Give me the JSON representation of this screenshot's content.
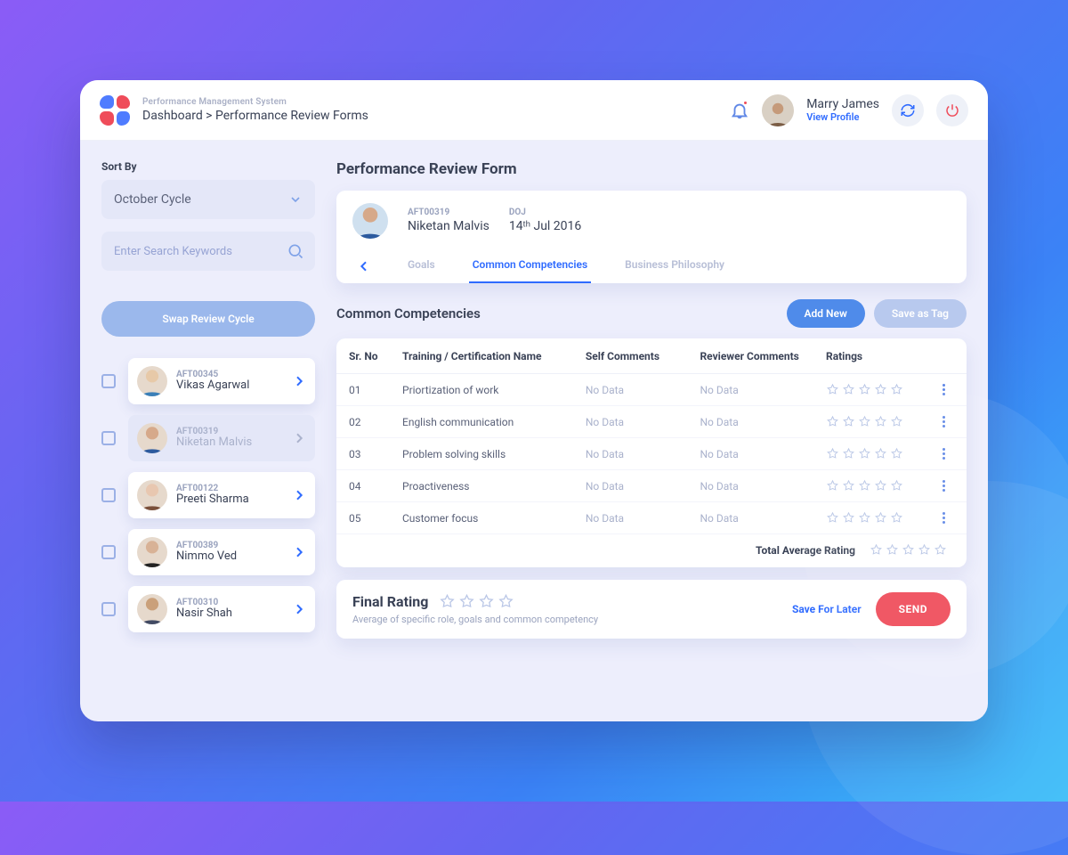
{
  "header": {
    "app_name": "Performance Management System",
    "breadcrumb": "Dashboard > Performance Review Forms",
    "user_name": "Marry James",
    "profile_link": "View Profile"
  },
  "sidebar": {
    "sort_label": "Sort By",
    "sort_value": "October Cycle",
    "search_placeholder": "Enter Search Keywords",
    "swap_label": "Swap Review Cycle",
    "people": [
      {
        "id": "AFT00345",
        "name": "Vikas Agarwal",
        "selected": false
      },
      {
        "id": "AFT00319",
        "name": "Niketan Malvis",
        "selected": true
      },
      {
        "id": "AFT00122",
        "name": "Preeti Sharma",
        "selected": false
      },
      {
        "id": "AFT00389",
        "name": "Nimmo Ved",
        "selected": false
      },
      {
        "id": "AFT00310",
        "name": "Nasir Shah",
        "selected": false
      }
    ]
  },
  "main": {
    "title": "Performance Review Form",
    "employee": {
      "id": "AFT00319",
      "name": "Niketan Malvis",
      "doj_label": "DOJ",
      "doj_value": "14ᵗʰ Jul 2016"
    },
    "tabs": {
      "t0": "Goals",
      "t1": "Common Competencies",
      "t2": "Business Philosophy",
      "active": 1
    },
    "section_title": "Common Competencies",
    "add_new": "Add New",
    "save_tag": "Save as Tag",
    "columns": {
      "c0": "Sr. No",
      "c1": "Training / Certification Name",
      "c2": "Self Comments",
      "c3": "Reviewer Comments",
      "c4": "Ratings"
    },
    "rows": [
      {
        "no": "01",
        "name": "Priortization of work",
        "self": "No Data",
        "rev": "No Data"
      },
      {
        "no": "02",
        "name": "English communication",
        "self": "No Data",
        "rev": "No Data"
      },
      {
        "no": "03",
        "name": "Problem solving skills",
        "self": "No Data",
        "rev": "No Data"
      },
      {
        "no": "04",
        "name": "Proactiveness",
        "self": "No Data",
        "rev": "No Data"
      },
      {
        "no": "05",
        "name": "Customer focus",
        "self": "No Data",
        "rev": "No Data"
      }
    ],
    "total_label": "Total Average Rating",
    "final": {
      "label": "Final Rating",
      "sub": "Average of specific role, goals and common competency",
      "save": "Save For Later",
      "send": "SEND"
    }
  }
}
